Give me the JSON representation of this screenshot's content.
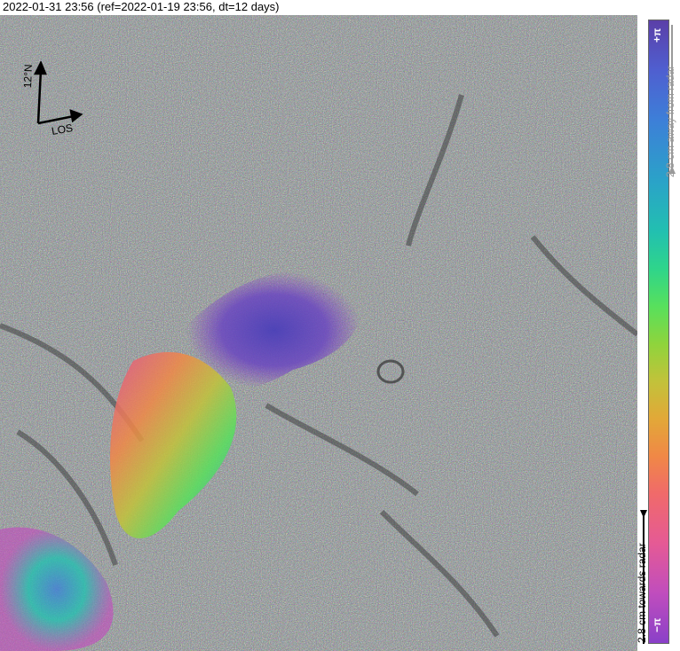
{
  "title": "2022-01-31 23:56 (ref=2022-01-19 23:56, dt=12 days)",
  "compass": {
    "north_label": "12°N",
    "los_label": "LOS"
  },
  "colorbar": {
    "top_label": "+π",
    "bottom_label": "−π",
    "away_label": "2.8 cm away from radar",
    "towards_label": "2.8 cm towards radar"
  },
  "colors": {
    "accent_away": "#5b3fa8",
    "accent_towards": "#8a40c8"
  }
}
